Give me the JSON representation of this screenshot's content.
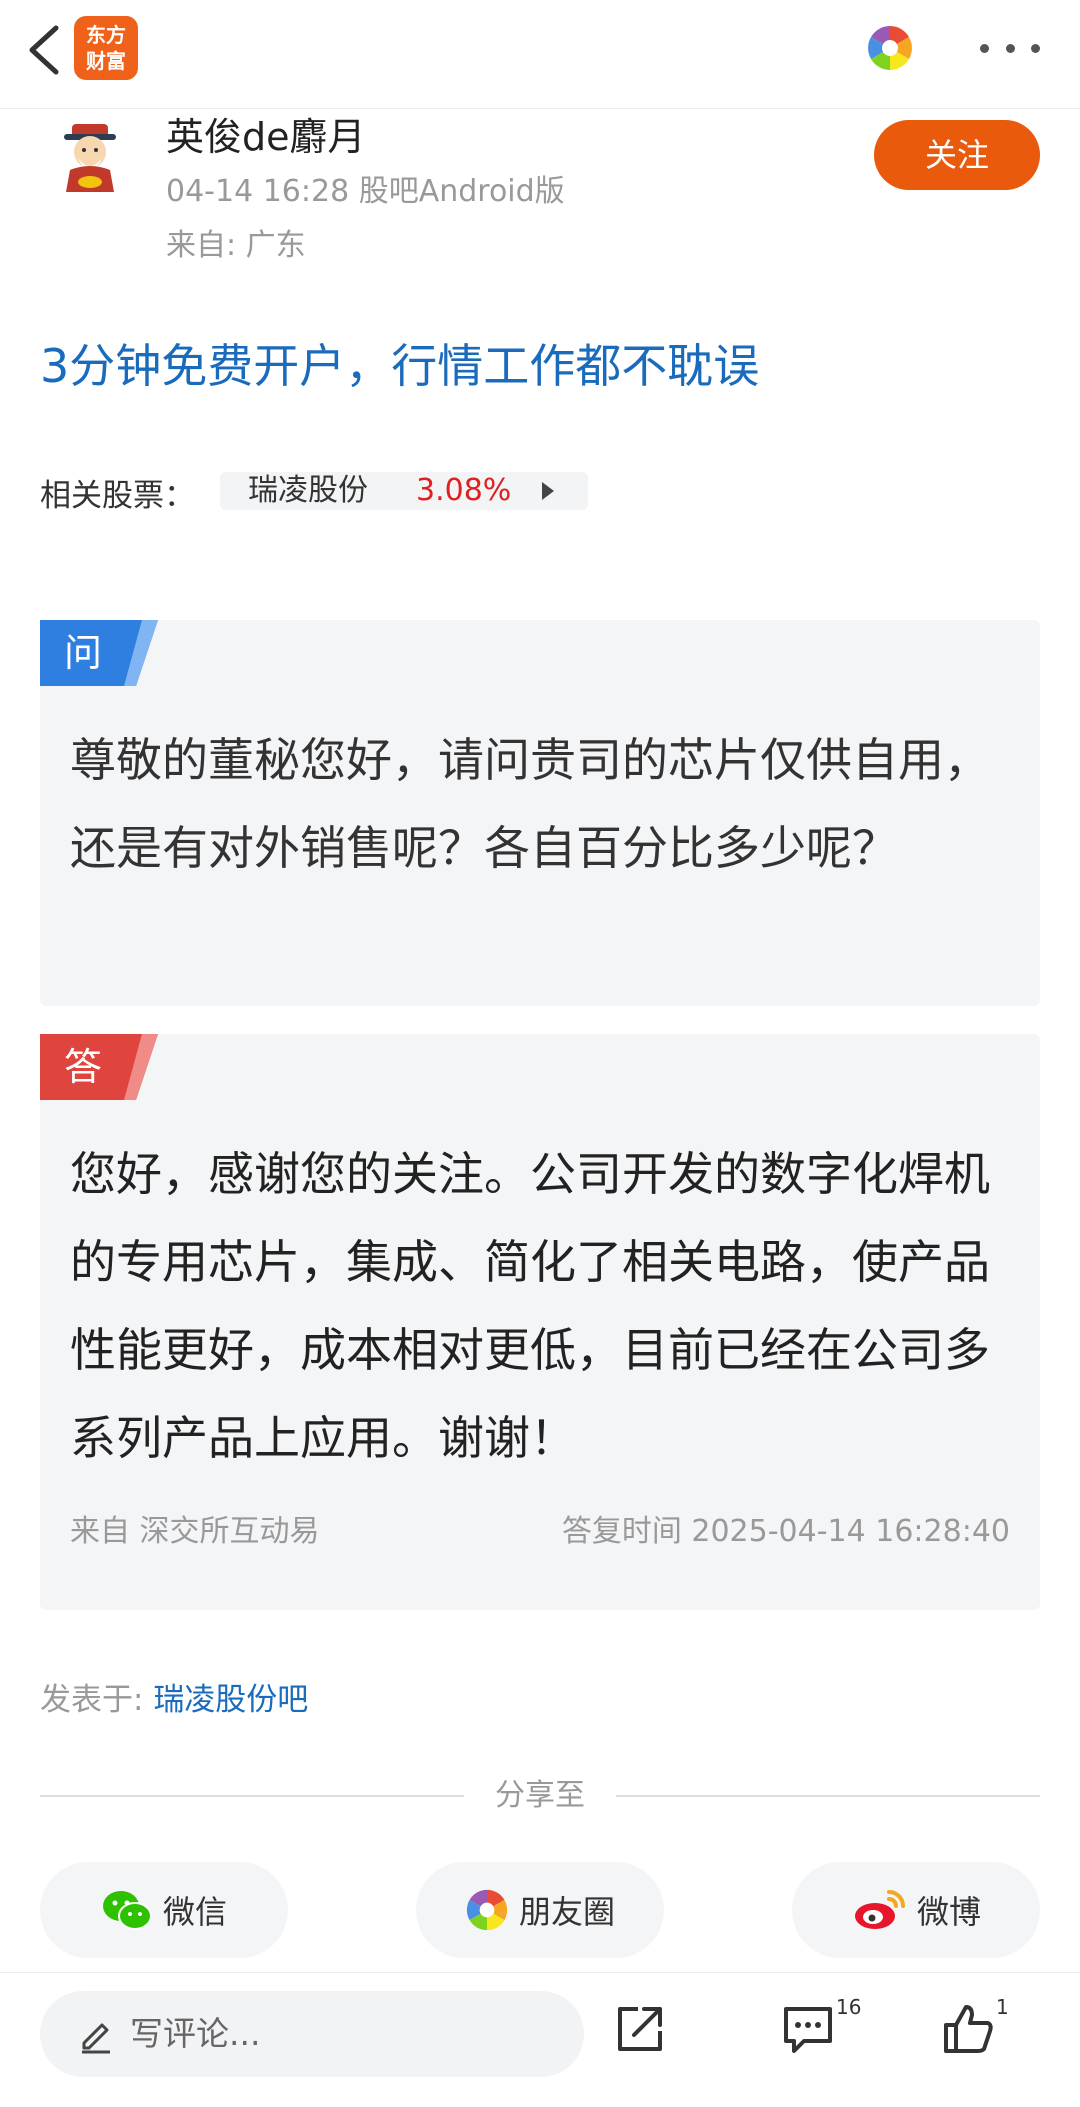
{
  "header": {
    "app_logo_line1": "东方",
    "app_logo_line2": "财富",
    "icons": [
      "back-icon",
      "pinwheel-icon",
      "more-icon"
    ]
  },
  "post": {
    "author": "英俊de麝月",
    "meta": "04-14 16:28 股吧Android版",
    "location": "来自: 广东",
    "follow_label": "关注",
    "promo": "3分钟免费开户，行情工作都不耽误",
    "related_label": "相关股票：",
    "stock_name": "瑞凌股份",
    "stock_change": "3.08%"
  },
  "question": {
    "tag": "问",
    "text": "尊敬的董秘您好，请问贵司的芯片仅供自用，还是有对外销售呢？各自百分比多少呢？"
  },
  "answer": {
    "tag": "答",
    "text": "您好，感谢您的关注。公司开发的数字化焊机的专用芯片，集成、简化了相关电路，使产品性能更好，成本相对更低，目前已经在公司多系列产品上应用。谢谢！",
    "source": "来自 深交所互动易",
    "time": "答复时间 2025-04-14 16:28:40"
  },
  "posted_in": {
    "label": "发表于: ",
    "bar": "瑞凌股份吧"
  },
  "share": {
    "title": "分享至",
    "wechat": "微信",
    "moments": "朋友圈",
    "weibo": "微博"
  },
  "bottom": {
    "comment_placeholder": "写评论...",
    "comment_count": "16",
    "like_count": "1"
  },
  "colors": {
    "brand_orange": "#e95a0c",
    "link_blue": "#1b6bbd",
    "up_red": "#e02020",
    "question_tag": "#2f7fe0",
    "answer_tag": "#e0443e"
  }
}
